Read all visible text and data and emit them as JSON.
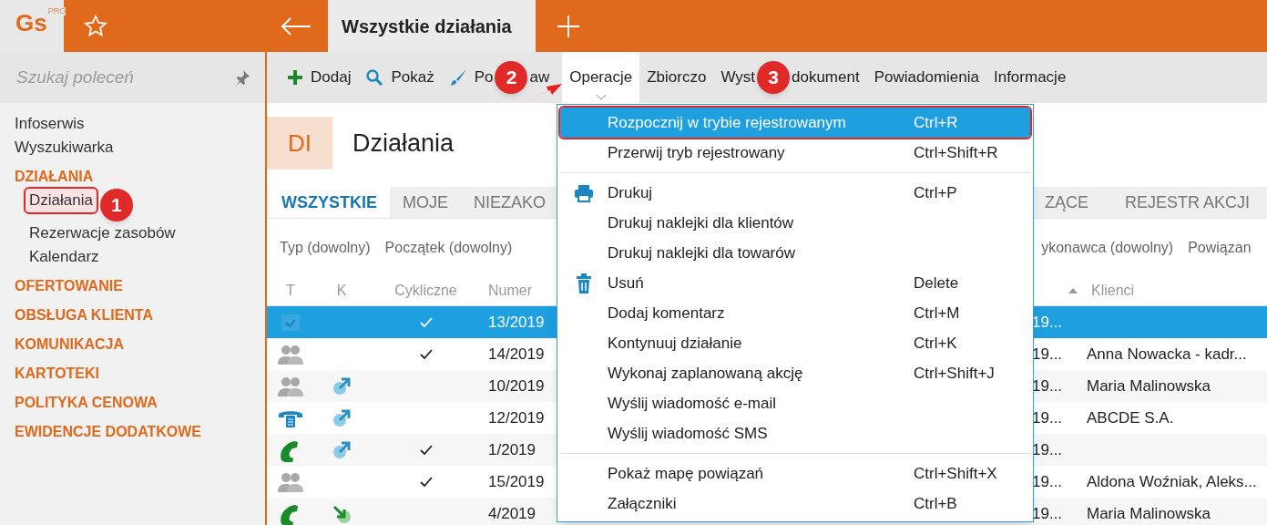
{
  "app": {
    "logo": "Gs",
    "logo_badge": "PRO",
    "tab": {
      "title": "Wszystkie działania",
      "selected": true
    }
  },
  "sidebar": {
    "search": {
      "placeholder": "Szukaj poleceń"
    },
    "items": [
      {
        "label": "Infoserwis",
        "kind": "link",
        "selected": false
      },
      {
        "label": "Wyszukiwarka",
        "kind": "link",
        "selected": false
      },
      {
        "label": "DZIAŁANIA",
        "kind": "section",
        "selected": false,
        "children": [
          {
            "label": "Działania",
            "kind": "link",
            "selected": true,
            "annotation": "1"
          },
          {
            "label": "Rezerwacje zasobów",
            "kind": "link",
            "selected": false
          },
          {
            "label": "Kalendarz",
            "kind": "link",
            "selected": false
          }
        ]
      },
      {
        "label": "OFERTOWANIE",
        "kind": "section",
        "selected": false
      },
      {
        "label": "OBSŁUGA KLIENTA",
        "kind": "section",
        "selected": false
      },
      {
        "label": "KOMUNIKACJA",
        "kind": "section",
        "selected": false
      },
      {
        "label": "KARTOTEKI",
        "kind": "section",
        "selected": false
      },
      {
        "label": "POLITYKA CENOWA",
        "kind": "section",
        "selected": false
      },
      {
        "label": "EWIDENCJE DODATKOWE",
        "kind": "section",
        "selected": false
      }
    ]
  },
  "toolbar": [
    {
      "label": "Dodaj",
      "kind": "plus",
      "selected": false
    },
    {
      "label": "Pokaż",
      "kind": "search",
      "selected": false
    },
    {
      "label": "Po",
      "label_after": "aw",
      "annotation": "2",
      "kind": "brush",
      "selected": false
    },
    {
      "label": "Operacje",
      "kind": "text",
      "selected": true
    },
    {
      "label": "Zbiorczo",
      "kind": "text",
      "selected": false
    },
    {
      "label": "Wyst",
      "label_after": "dokument",
      "annotation": "3",
      "kind": "text",
      "selected": false
    },
    {
      "label": "Powiadomienia",
      "kind": "text",
      "selected": false
    },
    {
      "label": "Informacje",
      "kind": "text",
      "selected": false
    }
  ],
  "header": {
    "badge": "DI",
    "title": "Działania"
  },
  "view_tabs": [
    {
      "label": "WSZYSTKIE",
      "selected": true
    },
    {
      "label": "MOJE",
      "selected": false
    },
    {
      "label": "NIEZAKO",
      "selected": false
    },
    {
      "label": "ZĄCE",
      "selected": false
    },
    {
      "label": "REJESTR AKCJI",
      "selected": false
    }
  ],
  "filters": [
    "Typ (dowolny)",
    "Początek (dowolny)",
    "ykonawca (dowolny)",
    "Powiązan"
  ],
  "table": {
    "columns": [
      "T",
      "K",
      "Cykliczne",
      "Numer",
      "Klienci"
    ],
    "rows": [
      {
        "t": {
          "kind": "done"
        },
        "cyclic": true,
        "number": "13/2019",
        "column_5": "19...",
        "clients": "",
        "selected": true
      },
      {
        "t": {
          "kind": "meeting"
        },
        "cyclic": true,
        "number": "14/2019",
        "column_5": "19...",
        "clients": "Anna Nowacka - kadr...",
        "selected": false
      },
      {
        "t": {
          "kind": "meeting"
        },
        "k": {
          "kind": "out"
        },
        "cyclic": false,
        "number": "10/2019",
        "column_5": "19...",
        "clients": "Maria Malinowska",
        "selected": false
      },
      {
        "t": {
          "kind": "fax"
        },
        "k": {
          "kind": "out"
        },
        "cyclic": false,
        "number": "12/2019",
        "column_5": "19...",
        "clients": "ABCDE S.A.",
        "selected": false
      },
      {
        "t": {
          "kind": "call"
        },
        "k": {
          "kind": "out"
        },
        "cyclic": true,
        "number": "1/2019",
        "column_5": "19...",
        "clients": "",
        "selected": false
      },
      {
        "t": {
          "kind": "meeting"
        },
        "cyclic": true,
        "number": "15/2019",
        "column_5": "19...",
        "clients": "Aldona Woźniak, Aleks...",
        "selected": false
      },
      {
        "t": {
          "kind": "call"
        },
        "k": {
          "kind": "in"
        },
        "cyclic": false,
        "number": "4/2019",
        "column_5": "19...",
        "clients": "Maria Malinowska",
        "selected": false
      }
    ]
  },
  "menu": {
    "groups": [
      [
        {
          "label": "Rozpocznij w trybie rejestrowanym",
          "shortcut": "Ctrl+R",
          "kind": "text",
          "selected": true
        },
        {
          "label": "Przerwij tryb rejestrowany",
          "shortcut": "Ctrl+Shift+R",
          "kind": "text",
          "selected": false
        }
      ],
      [
        {
          "label": "Drukuj",
          "shortcut": "Ctrl+P",
          "kind": "printer",
          "selected": false
        },
        {
          "label": "Drukuj naklejki dla klientów",
          "kind": "text",
          "selected": false
        },
        {
          "label": "Drukuj naklejki dla towarów",
          "kind": "text",
          "selected": false
        },
        {
          "label": "Usuń",
          "shortcut": "Delete",
          "kind": "trash",
          "selected": false
        },
        {
          "label": "Dodaj komentarz",
          "shortcut": "Ctrl+M",
          "kind": "text",
          "selected": false
        },
        {
          "label": "Kontynuuj działanie",
          "shortcut": "Ctrl+K",
          "kind": "text",
          "selected": false
        },
        {
          "label": "Wykonaj zaplanowaną akcję",
          "shortcut": "Ctrl+Shift+J",
          "kind": "text",
          "selected": false
        },
        {
          "label": "Wyślij wiadomość e-mail",
          "kind": "text",
          "selected": false
        },
        {
          "label": "Wyślij wiadomość SMS",
          "kind": "text",
          "selected": false
        }
      ],
      [
        {
          "label": "Pokaż mapę powiązań",
          "shortcut": "Ctrl+Shift+X",
          "kind": "text",
          "selected": false
        },
        {
          "label": "Załączniki",
          "shortcut": "Ctrl+B",
          "kind": "text",
          "selected": false
        }
      ]
    ]
  }
}
